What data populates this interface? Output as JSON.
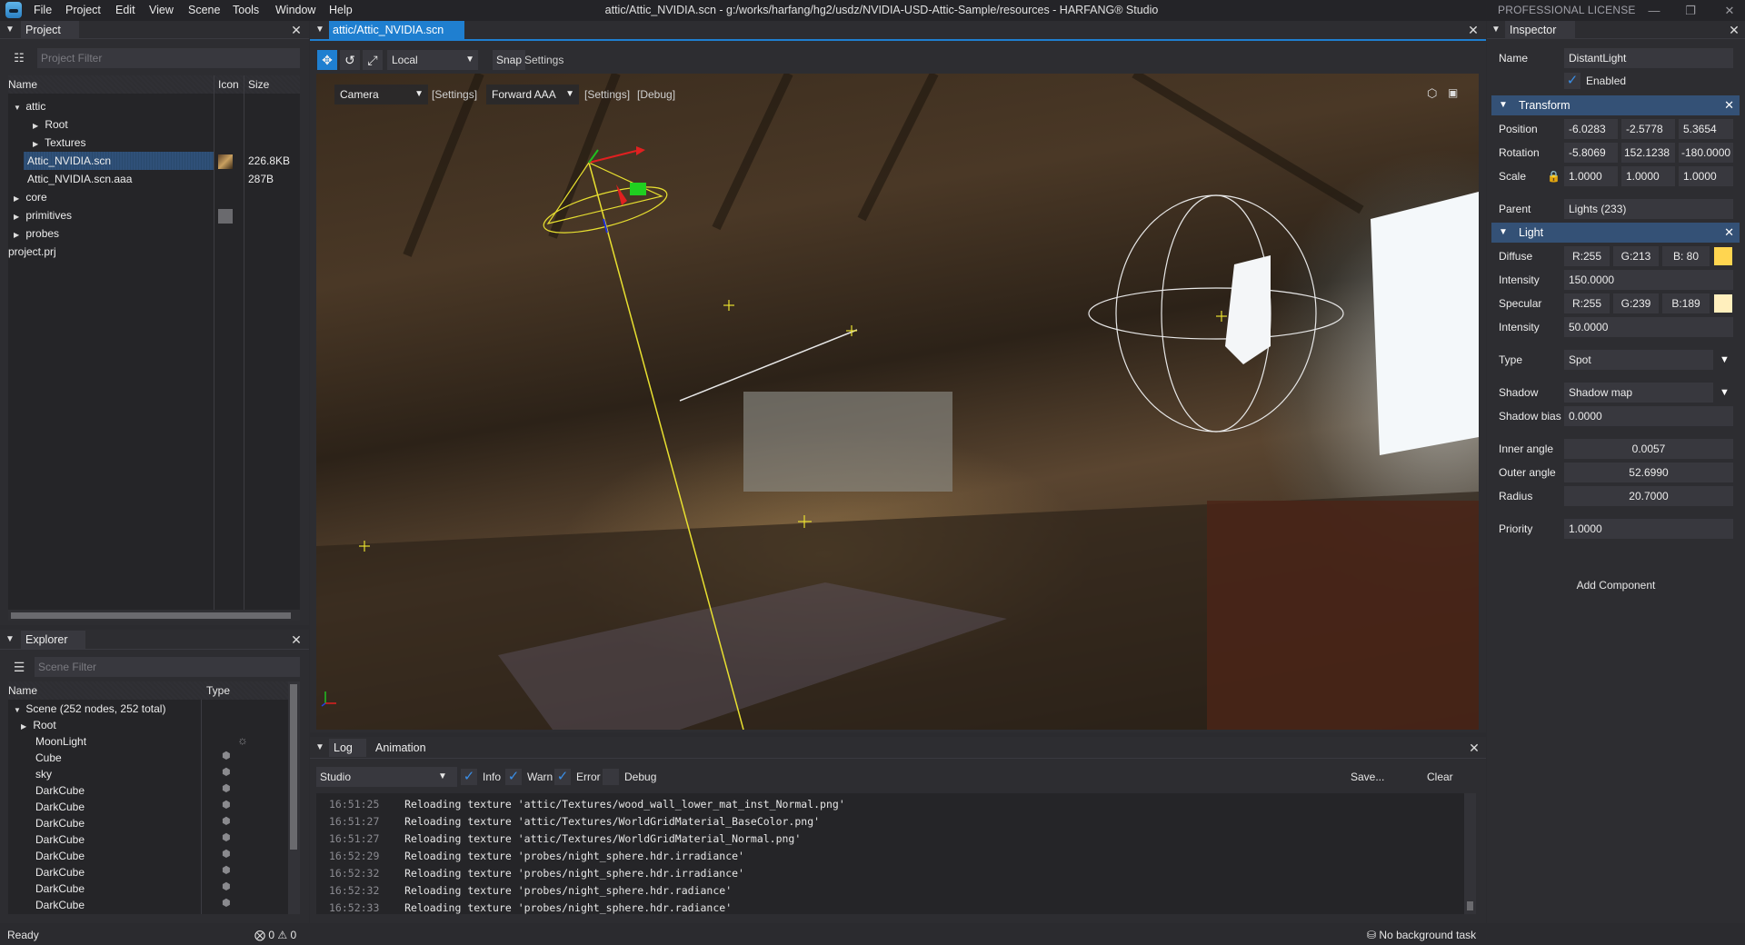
{
  "app": {
    "window_title": "attic/Attic_NVIDIA.scn - g:/works/harfang/hg2/usdz/NVIDIA-USD-Attic-Sample/resources - HARFANG® Studio",
    "license": "PROFESSIONAL LICENSE",
    "menu": [
      "File",
      "Project",
      "Edit",
      "View",
      "Scene",
      "Tools",
      "Window",
      "Help"
    ],
    "accent_color": "#1f7fd0"
  },
  "project": {
    "tab": "Project",
    "filter_placeholder": "Project Filter",
    "columns": [
      "Name",
      "Icon",
      "Size"
    ],
    "rows": [
      {
        "name": "attic",
        "expanded": true,
        "depth": 0,
        "size": ""
      },
      {
        "name": "Root",
        "expanded": false,
        "depth": 1,
        "size": ""
      },
      {
        "name": "Textures",
        "expanded": false,
        "depth": 1,
        "size": ""
      },
      {
        "name": "Attic_NVIDIA.scn",
        "depth": 1,
        "size": "226.8KB",
        "selected": true,
        "icon": "scene-thumbnail"
      },
      {
        "name": "Attic_NVIDIA.scn.aaa",
        "depth": 1,
        "size": "287B"
      },
      {
        "name": "core",
        "expanded": false,
        "depth": 0,
        "size": ""
      },
      {
        "name": "primitives",
        "expanded": false,
        "depth": 0,
        "size": "",
        "icon": "primitive-thumbnail"
      },
      {
        "name": "probes",
        "expanded": false,
        "depth": 0,
        "size": ""
      },
      {
        "name": "project.prj",
        "depth": -1,
        "size": ""
      }
    ]
  },
  "explorer": {
    "tab": "Explorer",
    "filter_placeholder": "Scene Filter",
    "columns": [
      "Name",
      "Type"
    ],
    "root": "Scene (252 nodes, 252 total)",
    "nodes": [
      {
        "name": "Root",
        "expandable": true,
        "type": ""
      },
      {
        "name": "MoonLight",
        "type": "light"
      },
      {
        "name": "Cube",
        "type": "object"
      },
      {
        "name": "sky",
        "type": "object"
      },
      {
        "name": "DarkCube",
        "type": "object"
      },
      {
        "name": "DarkCube",
        "type": "object"
      },
      {
        "name": "DarkCube",
        "type": "object"
      },
      {
        "name": "DarkCube",
        "type": "object"
      },
      {
        "name": "DarkCube",
        "type": "object"
      },
      {
        "name": "DarkCube",
        "type": "object"
      },
      {
        "name": "DarkCube",
        "type": "object"
      },
      {
        "name": "DarkCube",
        "type": "object"
      }
    ]
  },
  "viewport": {
    "tab": "attic/Attic_NVIDIA.scn",
    "space": "Local",
    "snap": "Snap",
    "settings": "Settings",
    "camera": "Camera",
    "camera_settings": "[Settings]",
    "pipeline": "Forward AAA",
    "pipeline_settings": "[Settings]",
    "debug": "[Debug]"
  },
  "log": {
    "tabs": [
      "Log",
      "Animation"
    ],
    "source": "Studio",
    "filters": [
      {
        "label": "Info",
        "checked": true
      },
      {
        "label": "Warn",
        "checked": true
      },
      {
        "label": "Error",
        "checked": true
      },
      {
        "label": "Debug",
        "checked": false
      }
    ],
    "save": "Save...",
    "clear": "Clear",
    "entries": [
      {
        "time": "16:51:25",
        "msg": "Reloading texture 'attic/Textures/wood_wall_lower_mat_inst_Normal.png'"
      },
      {
        "time": "16:51:27",
        "msg": "Reloading texture 'attic/Textures/WorldGridMaterial_BaseColor.png'"
      },
      {
        "time": "16:51:27",
        "msg": "Reloading texture 'attic/Textures/WorldGridMaterial_Normal.png'"
      },
      {
        "time": "16:52:29",
        "msg": "Reloading texture 'probes/night_sphere.hdr.irradiance'"
      },
      {
        "time": "16:52:32",
        "msg": "Reloading texture 'probes/night_sphere.hdr.irradiance'"
      },
      {
        "time": "16:52:32",
        "msg": "Reloading texture 'probes/night_sphere.hdr.radiance'"
      },
      {
        "time": "16:52:33",
        "msg": "Reloading texture 'probes/night_sphere.hdr.radiance'"
      }
    ]
  },
  "inspector": {
    "tab": "Inspector",
    "name_label": "Name",
    "name": "DistantLight",
    "enabled_label": "Enabled",
    "transform": {
      "title": "Transform",
      "position_label": "Position",
      "position": [
        "-6.0283",
        "-2.5778",
        "5.3654"
      ],
      "rotation_label": "Rotation",
      "rotation": [
        "-5.8069",
        "152.1238",
        "-180.0000"
      ],
      "scale_label": "Scale",
      "scale": [
        "1.0000",
        "1.0000",
        "1.0000"
      ]
    },
    "parent_label": "Parent",
    "parent": "Lights (233)",
    "light": {
      "title": "Light",
      "diffuse_label": "Diffuse",
      "diffuse": [
        "R:255",
        "G:213",
        "B: 80"
      ],
      "diffuse_color": "#ffd550",
      "diffuse_intensity_label": "Intensity",
      "diffuse_intensity": "150.0000",
      "specular_label": "Specular",
      "specular": [
        "R:255",
        "G:239",
        "B:189"
      ],
      "specular_color": "#ffefbd",
      "specular_intensity_label": "Intensity",
      "specular_intensity": "50.0000",
      "type_label": "Type",
      "type": "Spot",
      "shadow_label": "Shadow",
      "shadow": "Shadow map",
      "shadow_bias_label": "Shadow bias",
      "shadow_bias": "0.0000",
      "inner_angle_label": "Inner angle",
      "inner_angle": "0.0057",
      "outer_angle_label": "Outer angle",
      "outer_angle": "52.6990",
      "radius_label": "Radius",
      "radius": "20.7000",
      "priority_label": "Priority",
      "priority": "1.0000"
    },
    "add_component": "Add Component"
  },
  "status": {
    "text": "Ready",
    "errors": "0",
    "warnings": "0",
    "background_task": "No background task"
  }
}
